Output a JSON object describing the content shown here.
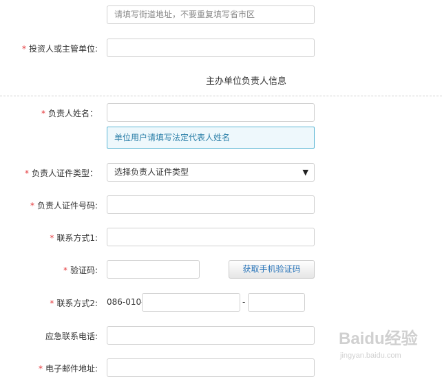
{
  "address_hint": {
    "placeholder": "请填写街道地址，不要重复填写省市区"
  },
  "fields": {
    "investor": {
      "required": "*",
      "label": "投资人或主管单位:"
    },
    "section_title": "主办单位负责人信息",
    "leader_name": {
      "required": "*",
      "label": "负责人姓名：",
      "hint": "单位用户请填写法定代表人姓名"
    },
    "id_type": {
      "required": "*",
      "label": "负责人证件类型：",
      "selected": "选择负责人证件类型",
      "arrow": "▼"
    },
    "id_number": {
      "required": "*",
      "label": "负责人证件号码:"
    },
    "contact1": {
      "required": "*",
      "label": "联系方式1:"
    },
    "verify_code": {
      "required": "*",
      "label": "验证码:",
      "button": "获取手机验证码"
    },
    "contact2": {
      "required": "*",
      "label": "联系方式2:",
      "prefix": "086-010-",
      "separator": "-"
    },
    "emergency_phone": {
      "label": "应急联系电话:"
    },
    "email": {
      "required": "*",
      "label": "电子邮件地址:"
    }
  },
  "watermark": {
    "brand": "Baidu经验",
    "url": "jingyan.baidu.com"
  },
  "colors": {
    "required": "#e4393c",
    "hint_border": "#5ab6d4",
    "hint_text": "#2b7fa8",
    "button_text": "#2c76b9"
  }
}
